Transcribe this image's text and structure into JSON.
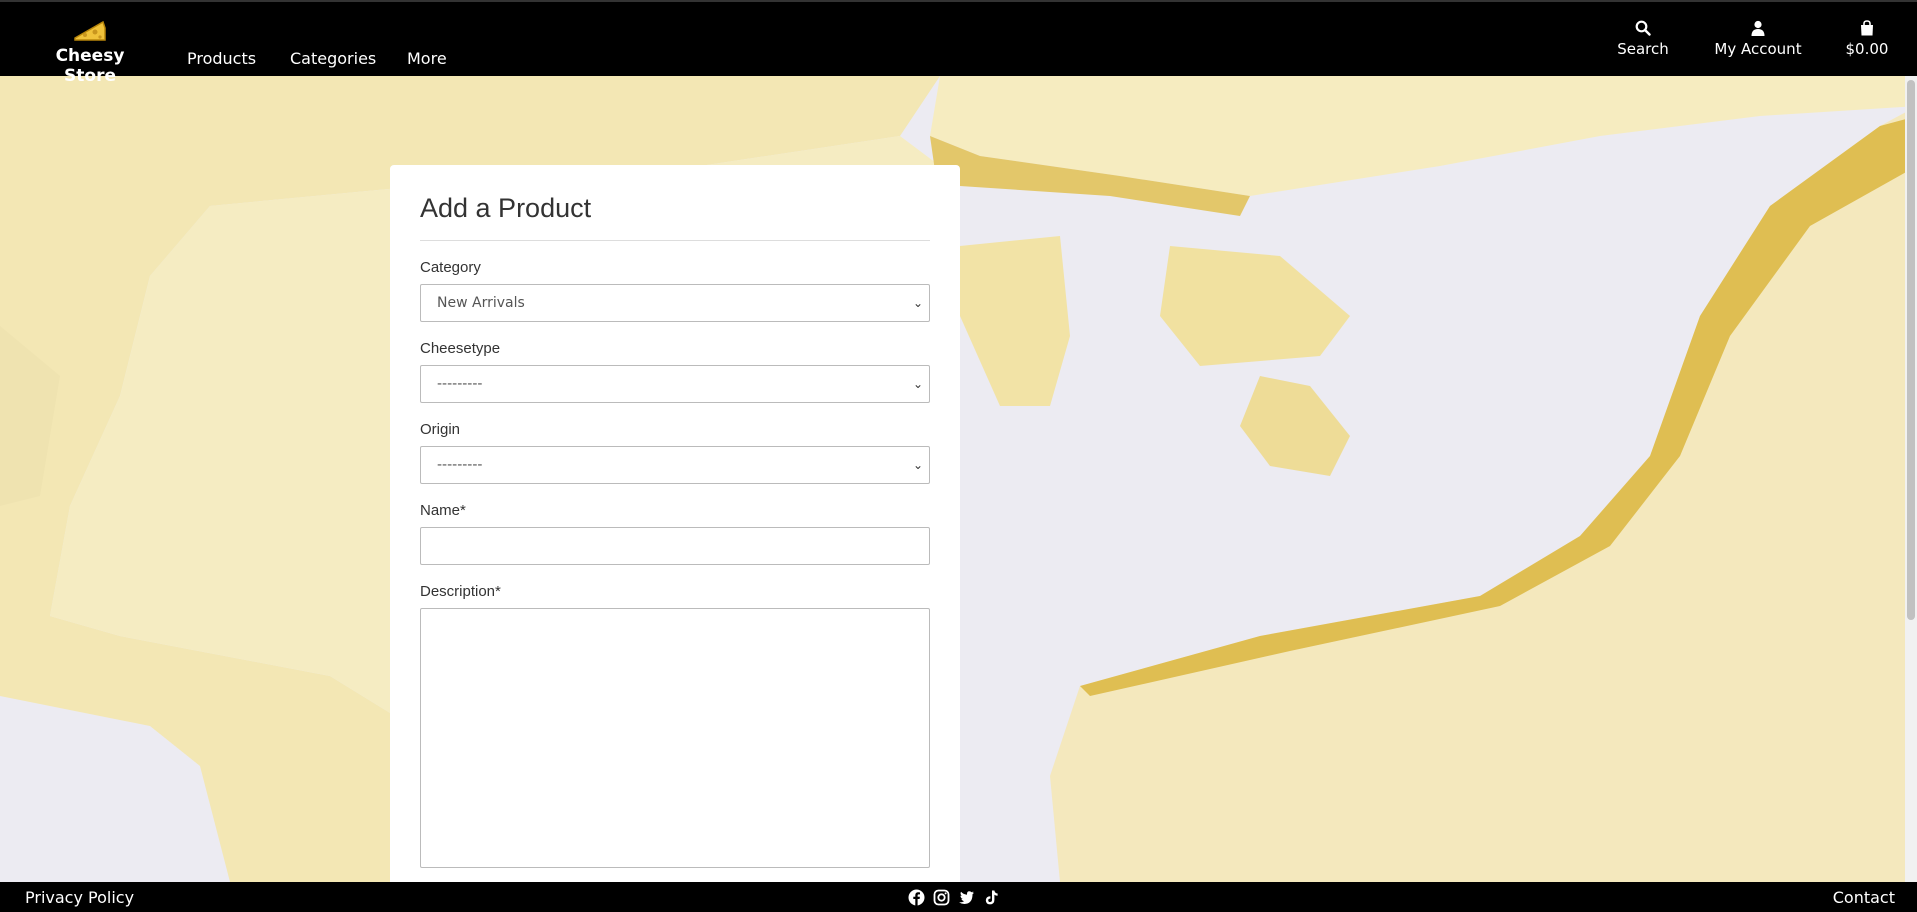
{
  "navbar": {
    "brand": "Cheesy Store",
    "links": [
      "Products",
      "Categories",
      "More"
    ],
    "search_label": "Search",
    "account_label": "My Account",
    "cart_total": "$0.00"
  },
  "form": {
    "title": "Add a Product",
    "category_label": "Category",
    "category_value": "New Arrivals",
    "cheesetype_label": "Cheesetype",
    "cheesetype_value": "---------",
    "origin_label": "Origin",
    "origin_value": "---------",
    "name_label": "Name*",
    "description_label": "Description*"
  },
  "footer": {
    "privacy": "Privacy Policy",
    "contact": "Contact",
    "social_icons": [
      "facebook-icon",
      "instagram-icon",
      "twitter-icon",
      "tiktok-icon"
    ]
  },
  "colors": {
    "nav_bg": "#000000",
    "cheese": "#f3e7b4",
    "cheese_rind": "#d8b44e",
    "plate": "#ecebf2"
  }
}
